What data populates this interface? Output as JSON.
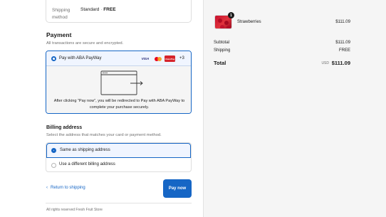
{
  "shipping": {
    "method_label": "Shipping method",
    "method_value": "Standard",
    "separator": "·",
    "method_price": "FREE"
  },
  "payment": {
    "title": "Payment",
    "subtitle": "All transactions are secure and encrypted.",
    "option_label": "Pay with ABA PayWay",
    "card_brands": [
      "VISA",
      "mastercard",
      "UnionPay"
    ],
    "more_count": "+3",
    "redirect_text": "After clicking “Pay now”, you will be redirected to Pay with ABA PayWay to complete your purchase securely."
  },
  "billing": {
    "title": "Billing address",
    "subtitle": "Select the address that matches your card or payment method.",
    "options": [
      {
        "label": "Same as shipping address",
        "selected": true
      },
      {
        "label": "Use a different billing address",
        "selected": false
      }
    ]
  },
  "actions": {
    "return_label": "Return to shipping",
    "pay_label": "Pay now"
  },
  "footer": {
    "text": "All rights reserved Fresh Fruit Store"
  },
  "summary": {
    "item": {
      "name": "Strawberries",
      "quantity": "1",
      "price": "$111.09"
    },
    "subtotal_label": "Subtotal",
    "subtotal_value": "$111.09",
    "shipping_label": "Shipping",
    "shipping_value": "FREE",
    "total_label": "Total",
    "currency": "USD",
    "total_value": "$111.09"
  },
  "colors": {
    "accent": "#1666c5",
    "sidebar_bg": "#f5f5f5"
  },
  "icons": [
    "radio-selected-icon",
    "redirect-window-icon",
    "chevron-left-icon"
  ]
}
